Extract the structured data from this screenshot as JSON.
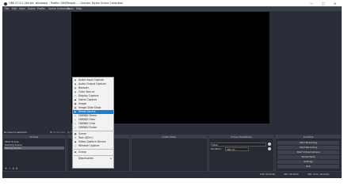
{
  "window": {
    "title": "OBS 27.0.1 (64-bit, windows) - Profile: OBSPeople... - Scenes: Mylan Scene Collection",
    "controls": [
      "—",
      "□",
      "✕"
    ]
  },
  "menu": [
    "File",
    "Edit",
    "View",
    "Docks",
    "Profile",
    "Scene Collection",
    "Tools",
    "Help"
  ],
  "source_bar": {
    "status": "No source selected",
    "properties": "Properties",
    "filters": "Filters"
  },
  "scenes": {
    "title": "Scenes",
    "items": [
      "Start Scene",
      "Gaming Scene",
      "Talking Scene"
    ],
    "selected": 2,
    "footer": "+ − ∧ ∨"
  },
  "sources": {
    "title": "Sources"
  },
  "audio_mixer": {
    "title": "Audio Mixer"
  },
  "transitions": {
    "title": "Scene Transitions",
    "type": "Fade",
    "duration_label": "Duration",
    "duration_value": "300 ms"
  },
  "controls_dock": {
    "title": "Controls",
    "buttons": [
      "Start Streaming",
      "Start Recording",
      "Start Virtual Camera",
      "Studio Mode",
      "Settings",
      "Exit"
    ]
  },
  "context_menu": {
    "items": [
      {
        "label": "Audio Input Capture",
        "icon": "microphone-icon"
      },
      {
        "label": "Audio Output Capture",
        "icon": "speaker-icon"
      },
      {
        "label": "Browser",
        "icon": "globe-icon"
      },
      {
        "label": "Color Source",
        "icon": "palette-icon"
      },
      {
        "label": "Display Capture",
        "icon": "monitor-icon"
      },
      {
        "label": "Game Capture",
        "icon": "gamepad-icon"
      },
      {
        "label": "Image",
        "icon": "image-icon"
      },
      {
        "label": "Image Slide Show",
        "icon": "slideshow-icon"
      },
      {
        "label": "Media Source",
        "icon": "play-icon"
      },
      {
        "label": "OBSNDI Demo",
        "icon": "ndi-icon"
      },
      {
        "label": "OBSNDI Filter",
        "icon": "ndi-icon"
      },
      {
        "label": "OBSNDI Chat",
        "icon": "ndi-icon"
      },
      {
        "label": "OBSNDI Finder",
        "icon": "ndi-icon"
      },
      {
        "label": "Scene",
        "icon": "scene-icon"
      },
      {
        "label": "Text (GDI+)",
        "icon": "text-icon"
      },
      {
        "label": "Video Capture Device",
        "icon": "camera-icon"
      },
      {
        "label": "Window Capture",
        "icon": "window-icon"
      },
      {
        "label": "Group",
        "icon": "folder-icon"
      },
      {
        "label": "Deprecated",
        "icon": ""
      }
    ],
    "selected": 8
  },
  "status": {
    "live": "LIVE: 00:00:00",
    "rec": "REC: 00:00:00",
    "cpu": "CPU: 0.2%, 30.00 fps"
  }
}
